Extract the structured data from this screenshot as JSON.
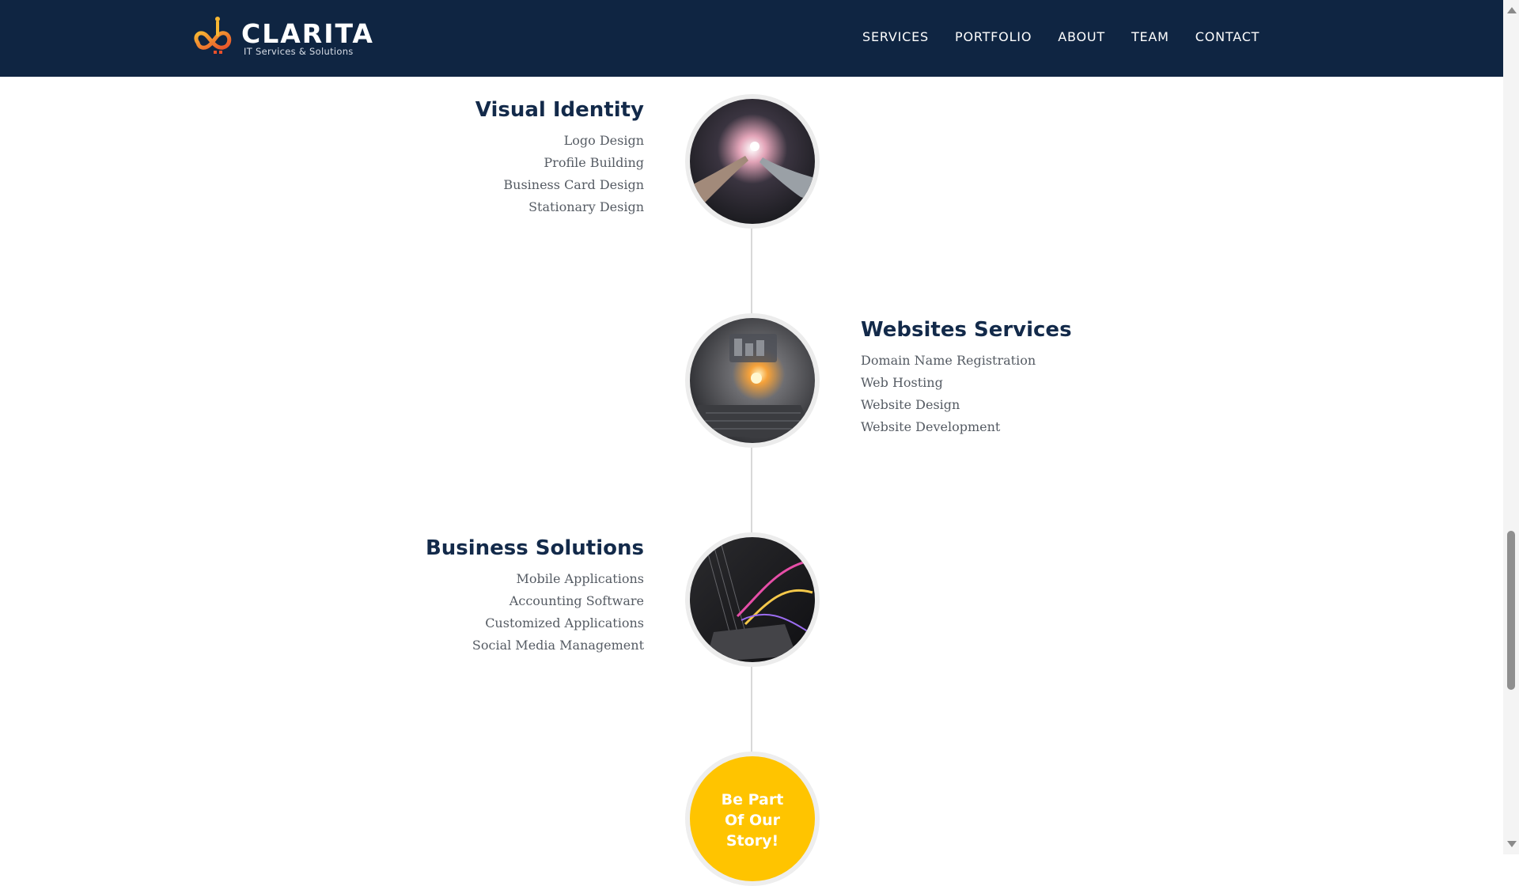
{
  "brand": {
    "name": "CLARITA",
    "tagline": "IT Services & Solutions"
  },
  "nav": {
    "items": [
      "SERVICES",
      "PORTFOLIO",
      "ABOUT",
      "TEAM",
      "CONTACT"
    ]
  },
  "services": [
    {
      "title": "Visual Identity",
      "items": [
        "Logo Design",
        "Profile Building",
        "Business Card Design",
        "Stationary Design"
      ],
      "image": "ai-robot-hand-icon"
    },
    {
      "title": "Websites Services",
      "items": [
        "Domain Name Registration",
        "Web Hosting",
        "Website Design",
        "Website Development"
      ],
      "image": "laptop-dashboard-icon"
    },
    {
      "title": "Business Solutions",
      "items": [
        "Mobile Applications",
        "Accounting Software",
        "Customized Applications",
        "Social Media Management"
      ],
      "image": "laptop-data-stream-icon"
    }
  ],
  "cta": {
    "line1": "Be Part",
    "line2": "Of Our",
    "line3": "Story!"
  },
  "colors": {
    "navbar": "#0f2542",
    "title": "#132a4a",
    "accent": "#ffc400",
    "logo_orange": "#f5a623"
  }
}
